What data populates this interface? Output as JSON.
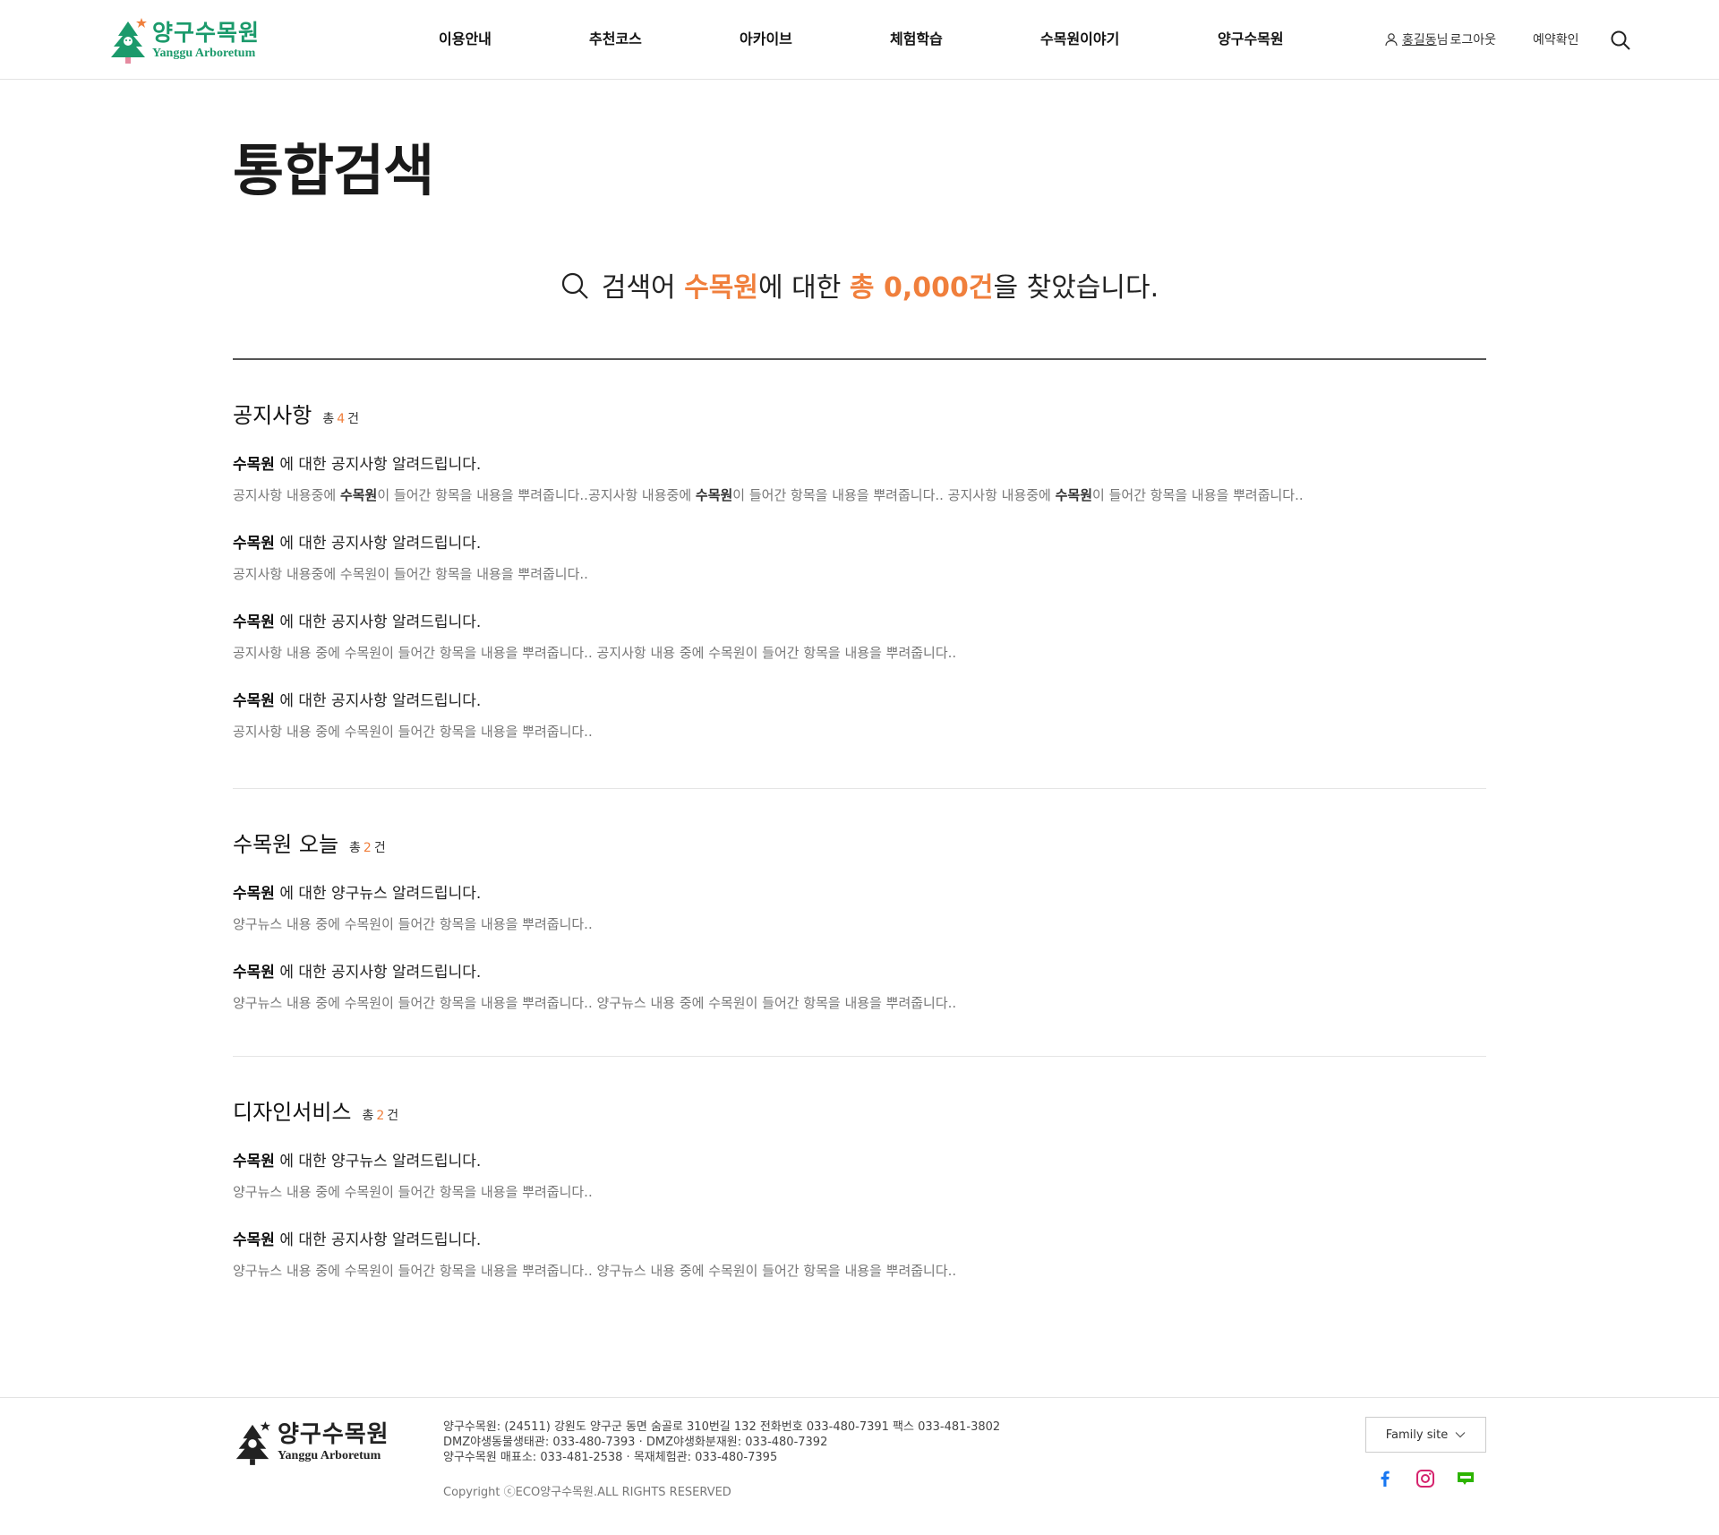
{
  "header": {
    "logo_ko": "양구수목원",
    "logo_en": "Yanggu Arboretum",
    "nav": [
      "이용안내",
      "추천코스",
      "아카이브",
      "체험학습",
      "수목원이야기",
      "양구수목원"
    ],
    "user_name": "홍길동",
    "user_suffix": "님",
    "logout": "로그아웃",
    "reservation": "예약확인"
  },
  "page": {
    "title": "통합검색"
  },
  "summary": {
    "prefix": "검색어",
    "keyword": "수목원",
    "middle": "에 대한",
    "total": "총 0,000건",
    "suffix": "을 찾았습니다."
  },
  "sections": [
    {
      "title": "공지사항",
      "count_prefix": "총",
      "count": "4",
      "count_suffix": "건",
      "items": [
        {
          "keyword": "수목원",
          "title_rest": " 에 대한 공지사항 알려드립니다.",
          "desc": [
            "공지사항 내용중에 ",
            "수목원",
            "이 들어간 항목을 내용을 뿌려줍니다..공지사항 내용중에 ",
            "수목원",
            "이 들어간 항목을 내용을 뿌려줍니다.. 공지사항 내용중에 ",
            "수목원",
            "이 들어간 항목을 내용을 뿌려줍니다.."
          ]
        },
        {
          "keyword": "수목원",
          "title_rest": " 에 대한 공지사항 알려드립니다.",
          "desc": [
            "공지사항 내용중에 수목원이 들어간 항목을 내용을 뿌려줍니다.."
          ]
        },
        {
          "keyword": "수목원",
          "title_rest": " 에 대한 공지사항 알려드립니다.",
          "desc": [
            "공지사항 내용 중에 수목원이 들어간 항목을 내용을 뿌려줍니다.. 공지사항 내용 중에 수목원이 들어간 항목을 내용을 뿌려줍니다.."
          ]
        },
        {
          "keyword": "수목원",
          "title_rest": " 에 대한 공지사항 알려드립니다.",
          "desc": [
            "공지사항 내용 중에 수목원이 들어간 항목을 내용을 뿌려줍니다.."
          ]
        }
      ]
    },
    {
      "title": "수목원 오늘",
      "count_prefix": "총",
      "count": "2",
      "count_suffix": "건",
      "items": [
        {
          "keyword": "수목원",
          "title_rest": " 에 대한 양구뉴스 알려드립니다.",
          "desc": [
            "양구뉴스 내용 중에 수목원이 들어간 항목을 내용을 뿌려줍니다.."
          ]
        },
        {
          "keyword": "수목원",
          "title_rest": " 에 대한 공지사항 알려드립니다.",
          "desc": [
            "양구뉴스 내용 중에 수목원이 들어간 항목을 내용을 뿌려줍니다.. 양구뉴스 내용 중에 수목원이 들어간 항목을 내용을 뿌려줍니다.."
          ]
        }
      ]
    },
    {
      "title": "디자인서비스",
      "count_prefix": "총",
      "count": "2",
      "count_suffix": "건",
      "items": [
        {
          "keyword": "수목원",
          "title_rest": " 에 대한 양구뉴스 알려드립니다.",
          "desc": [
            "양구뉴스 내용 중에 수목원이 들어간 항목을 내용을 뿌려줍니다.."
          ]
        },
        {
          "keyword": "수목원",
          "title_rest": " 에 대한 공지사항 알려드립니다.",
          "desc": [
            "양구뉴스 내용 중에 수목원이 들어간 항목을 내용을 뿌려줍니다.. 양구뉴스 내용 중에 수목원이 들어간 항목을 내용을 뿌려줍니다.."
          ]
        }
      ]
    }
  ],
  "footer": {
    "logo_ko": "양구수목원",
    "logo_en": "Yanggu Arboretum",
    "info_lines": [
      "양구수목원: (24511) 강원도 양구군 동면 숨골로 310번길 132 전화번호 033-480-7391 팩스 033-481-3802",
      "DMZ야생동물생태관: 033-480-7393 · DMZ야생화분재원: 033-480-7392",
      "양구수목원 매표소: 033-481-2538 · 목재체험관: 033-480-7395"
    ],
    "copyright": "Copyright ⓒECO양구수목원.ALL RIGHTS RESERVED",
    "family_site": "Family site",
    "sns": [
      "facebook-icon",
      "instagram-icon",
      "blog-icon"
    ]
  },
  "colors": {
    "accent": "#f07f3c",
    "brand_green": "#1b9a6b"
  }
}
